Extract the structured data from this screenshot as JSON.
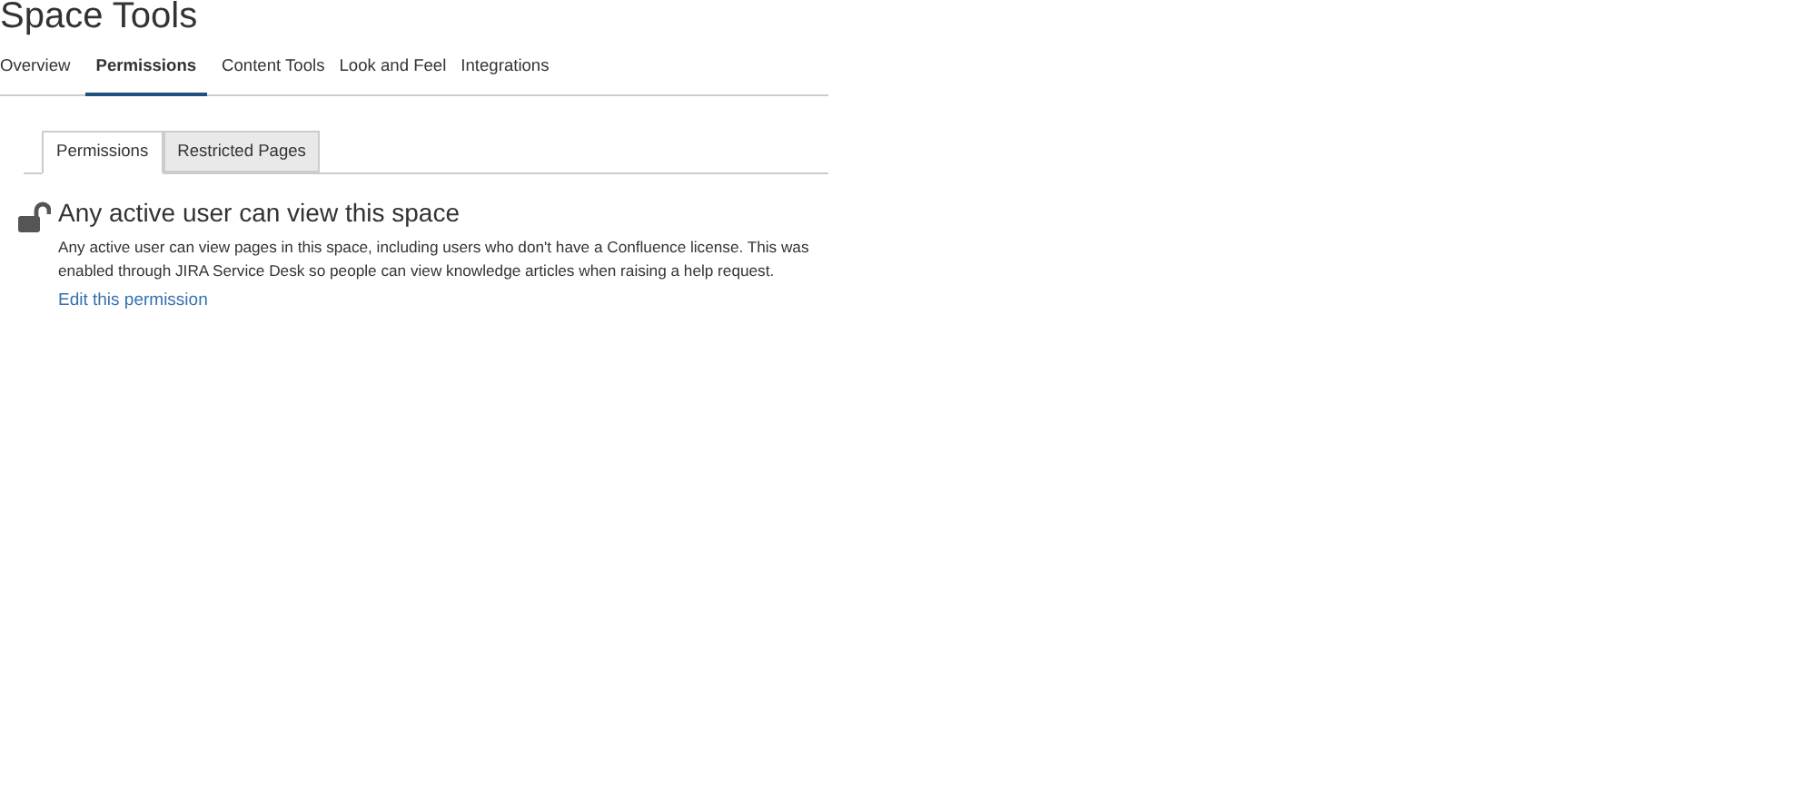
{
  "page": {
    "title": "Space Tools"
  },
  "tabs": [
    {
      "label": "Overview",
      "selected": false
    },
    {
      "label": "Permissions",
      "selected": true
    },
    {
      "label": "Content Tools",
      "selected": false
    },
    {
      "label": "Look and Feel",
      "selected": false
    },
    {
      "label": "Integrations",
      "selected": false
    }
  ],
  "subtabs": [
    {
      "label": "Permissions",
      "selected": true
    },
    {
      "label": "Restricted Pages",
      "selected": false
    }
  ],
  "notice": {
    "locked": false,
    "heading": "Any active user can view this space",
    "description": "Any active user can view pages in this space, including users who don't have a Confluence license. This was enabled through JIRA Service Desk so people can view knowledge articles when raising a help request.",
    "link": "Edit this permission"
  }
}
